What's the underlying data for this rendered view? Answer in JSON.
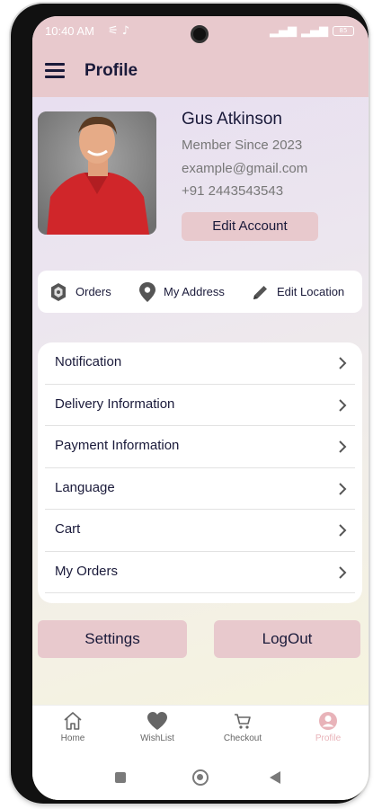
{
  "status": {
    "time": "10:40 AM",
    "battery": "85"
  },
  "appbar": {
    "title": "Profile"
  },
  "profile": {
    "name": "Gus Atkinson",
    "member_since": "Member Since 2023",
    "email": "example@gmail.com",
    "phone": "+91 2443543543",
    "edit_label": "Edit Account"
  },
  "quick_actions": [
    {
      "label": "Orders",
      "icon": "orders-icon"
    },
    {
      "label": "My Address",
      "icon": "location-pin-icon"
    },
    {
      "label": "Edit Location",
      "icon": "pencil-icon"
    }
  ],
  "menu": [
    {
      "label": "Notification"
    },
    {
      "label": "Delivery Information"
    },
    {
      "label": "Payment Information"
    },
    {
      "label": "Language"
    },
    {
      "label": "Cart"
    },
    {
      "label": "My Orders"
    }
  ],
  "buttons": {
    "settings": "Settings",
    "logout": "LogOut"
  },
  "nav": [
    {
      "label": "Home",
      "icon": "home-icon"
    },
    {
      "label": "WishList",
      "icon": "heart-icon"
    },
    {
      "label": "Checkout",
      "icon": "cart-icon"
    },
    {
      "label": "Profile",
      "icon": "profile-icon",
      "active": true
    }
  ],
  "colors": {
    "accent": "#e8c9cd",
    "text": "#1a1a3a",
    "active": "#e8b3b9"
  }
}
